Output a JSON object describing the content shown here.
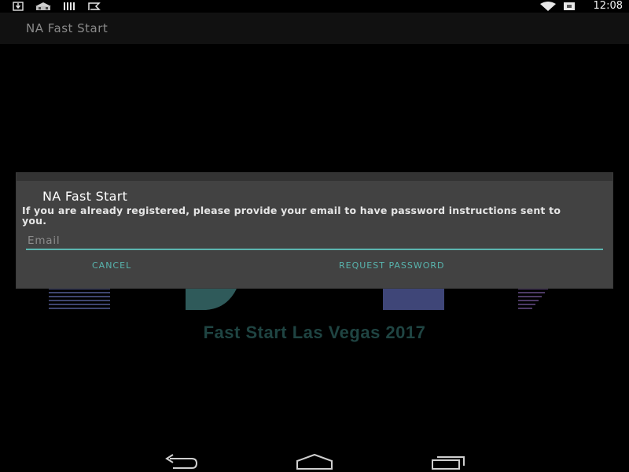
{
  "status_bar": {
    "time": "12:08",
    "left_icons": [
      "download-icon",
      "photo-icon",
      "barcode-icon",
      "flag-icon"
    ],
    "right_icons": [
      "wifi-icon",
      "battery-icon"
    ]
  },
  "action_bar": {
    "title": "NA Fast Start"
  },
  "splash": {
    "caption": "Fast Start Las Vegas 2017"
  },
  "dialog": {
    "title": "NA Fast Start",
    "message": "If you are already registered, please provide your email to have password instructions sent to you.",
    "email": {
      "value": "",
      "placeholder": "Email"
    },
    "cancel_label": "CANCEL",
    "request_label": "REQUEST PASSWORD",
    "accent_color": "#5cb5b0"
  },
  "nav_bar": {
    "icons": [
      "back-icon",
      "home-icon",
      "recent-apps-icon"
    ]
  }
}
